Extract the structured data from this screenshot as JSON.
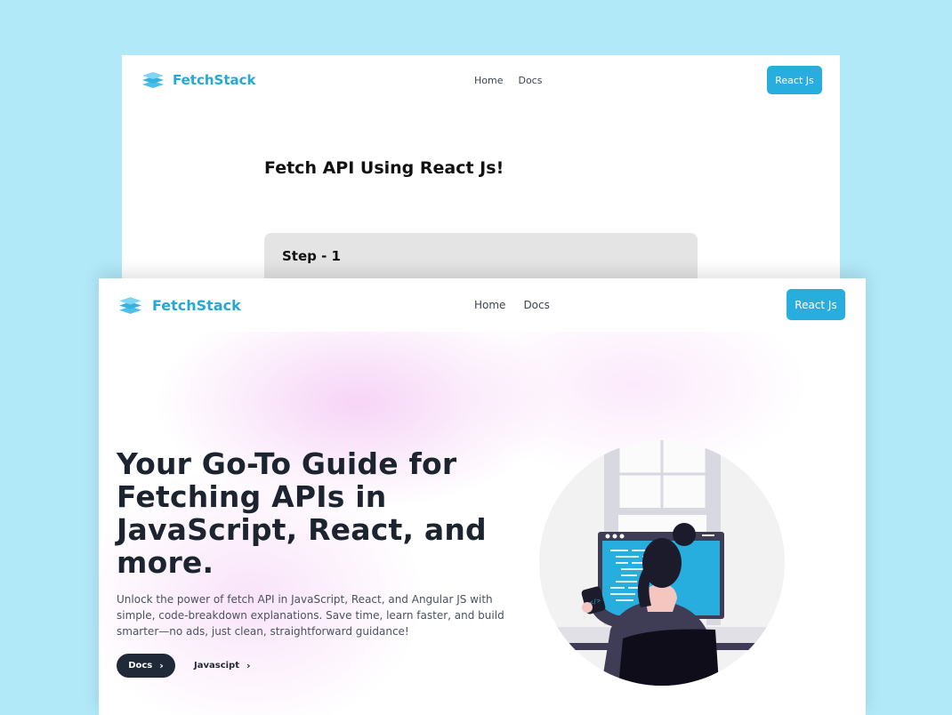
{
  "back_window": {
    "brand": "FetchStack",
    "nav": {
      "home": "Home",
      "docs": "Docs"
    },
    "cta": "React Js",
    "heading": "Fetch API Using React Js!",
    "step_label": "Step - 1"
  },
  "front_window": {
    "brand": "FetchStack",
    "nav": {
      "home": "Home",
      "docs": "Docs"
    },
    "cta": "React Js",
    "hero": {
      "title": "Your Go-To Guide for Fetching APIs in JavaScript, React, and more.",
      "description": "Unlock the power of fetch API in JavaScript, React, and Angular JS with simple, code-breakdown explanations. Save time, learn faster, and build smarter—no ads, just clean, straightforward guidance!",
      "primary_button": "Docs",
      "secondary_button": "Javascipt"
    }
  },
  "colors": {
    "page_background": "#b1e9f8",
    "brand": "#25a8d4",
    "button": "#28aede",
    "dark": "#1f2937"
  },
  "icons": {
    "logo": "stack-layers-icon",
    "chevron": "chevron-right-icon"
  }
}
